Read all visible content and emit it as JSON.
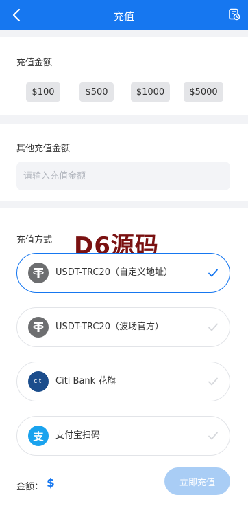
{
  "header": {
    "title": "充值",
    "back_icon": "chevron-left-icon",
    "record_icon": "recharge-record-icon",
    "background": "#1677f0"
  },
  "amount_section": {
    "label": "充值金额",
    "presets": [
      "$100",
      "$500",
      "$1000",
      "$5000"
    ]
  },
  "other_amount": {
    "label": "其他充值金额",
    "placeholder": "请输入充值金额",
    "value": ""
  },
  "method_section": {
    "label": "充值方式",
    "options": [
      {
        "label": "USDT-TRC20（自定义地址）",
        "icon": "tether-icon",
        "selected": true
      },
      {
        "label": "USDT-TRC20（波场官方）",
        "icon": "tether-icon",
        "selected": false
      },
      {
        "label": "Citi Bank 花旗",
        "icon": "citi-bank-icon",
        "selected": false
      },
      {
        "label": "支付宝扫码",
        "icon": "alipay-icon",
        "selected": false
      }
    ]
  },
  "watermark": "D6源码",
  "footer": {
    "total_label": "金额：",
    "total_value": "$",
    "submit_label": "立即充值"
  },
  "colors": {
    "accent": "#1677f0",
    "submit_disabled": "#a9cdf5",
    "watermark": "#7a1111"
  }
}
